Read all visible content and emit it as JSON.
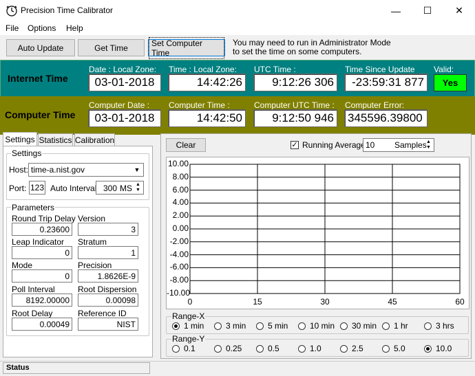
{
  "window": {
    "title": "Precision Time Calibrator",
    "minimize": "—",
    "maximize": "☐",
    "close": "✕"
  },
  "menu": {
    "file": "File",
    "options": "Options",
    "help": "Help"
  },
  "toolbar": {
    "auto_update": "Auto Update",
    "get_time": "Get Time",
    "set_computer_time": "Set Computer Time",
    "note_line1": "You may need to  run in Administrator Mode",
    "note_line2": "to set the time on some computers."
  },
  "internet": {
    "title": "Internet Time",
    "date_label": "Date : Local Zone:",
    "date_value": "03-01-2018",
    "time_label": "Time : Local Zone:",
    "time_value": "14:42:26",
    "utc_label": "UTC Time :",
    "utc_value": "9:12:26 306",
    "since_label": "Time Since Update",
    "since_value": "-23:59:31 877",
    "valid_label": "Valid:",
    "valid_value": "Yes",
    "valid_color": "#00ff00",
    "band_color": "#008080"
  },
  "computer": {
    "title": "Computer Time",
    "date_label": "Computer Date :",
    "date_value": "03-01-2018",
    "time_label": "Computer Time :",
    "time_value": "14:42:50",
    "utc_label": "Computer UTC Time :",
    "utc_value": "9:12:50 946",
    "error_label": "Computer Error:",
    "error_value": "345596.39800",
    "band_color": "#808000"
  },
  "tabs": [
    "Settings",
    "Statistics",
    "Calibration"
  ],
  "settings": {
    "group_label": "Settings",
    "host_label": "Host:",
    "host_value": "time-a.nist.gov",
    "port_label": "Port:",
    "port_value": "123",
    "interval_label": "Auto Interval",
    "interval_value": "300",
    "interval_unit": "MS"
  },
  "parameters": {
    "group_label": "Parameters",
    "items": [
      {
        "label": "Round Trip Delay",
        "value": "0.23600"
      },
      {
        "label": "Version",
        "value": "3"
      },
      {
        "label": "Leap Indicator",
        "value": "0"
      },
      {
        "label": "Stratum",
        "value": "1"
      },
      {
        "label": "Mode",
        "value": "0"
      },
      {
        "label": "Precision",
        "value": "1.8626E-9"
      },
      {
        "label": "Poll Interval",
        "value": "8192.00000"
      },
      {
        "label": "Root Dispersion",
        "value": "0.00098"
      },
      {
        "label": "Root Delay",
        "value": "0.00049"
      },
      {
        "label": "Reference ID",
        "value": "NIST"
      }
    ]
  },
  "graph_controls": {
    "clear": "Clear",
    "running_average_label": "Running Average",
    "running_average_checked": true,
    "samples_value": "10",
    "samples_unit": "Samples"
  },
  "chart_data": {
    "type": "line",
    "series": [],
    "y_ticks": [
      "10.00",
      "8.00",
      "6.00",
      "4.00",
      "2.00",
      "0.00",
      "-2.00",
      "-4.00",
      "-6.00",
      "-8.00",
      "-10.00"
    ],
    "x_ticks": [
      "0",
      "15",
      "30",
      "45",
      "60"
    ],
    "xlim": [
      0,
      60
    ],
    "ylim": [
      -10,
      10
    ],
    "grid": true
  },
  "range_x": {
    "label": "Range-X",
    "options": [
      "1 min",
      "3 min",
      "5 min",
      "10 min",
      "30 min",
      "1 hr",
      "3 hrs"
    ],
    "selected": "1 min"
  },
  "range_y": {
    "label": "Range-Y",
    "options": [
      "0.1",
      "0.25",
      "0.5",
      "1.0",
      "2.5",
      "5.0",
      "10.0"
    ],
    "selected": "10.0"
  },
  "status": {
    "label": "Status"
  }
}
